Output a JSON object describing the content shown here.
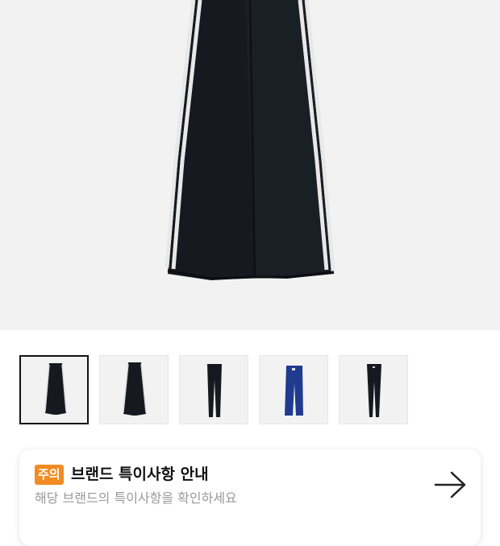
{
  "product": {
    "main_image": "wide-leg-track-pants-black-photo",
    "thumbnails": [
      {
        "name": "black-wide-pants-front",
        "selected": true
      },
      {
        "name": "black-wide-pants-back",
        "selected": false
      },
      {
        "name": "black-slim-pants",
        "selected": false
      },
      {
        "name": "navy-track-pants",
        "selected": false
      },
      {
        "name": "black-leggings",
        "selected": false
      }
    ]
  },
  "notice": {
    "badge": "주의",
    "title": "브랜드 특이사항 안내",
    "subtitle": "해당 브랜드의 특이사항을 확인하세요",
    "arrow_icon": "arrow-right-icon"
  },
  "colors": {
    "badge": "#f28b22",
    "pants_black": "#161a20",
    "pants_navy": "#1f3a8f",
    "stripe": "#e8e8e8"
  }
}
